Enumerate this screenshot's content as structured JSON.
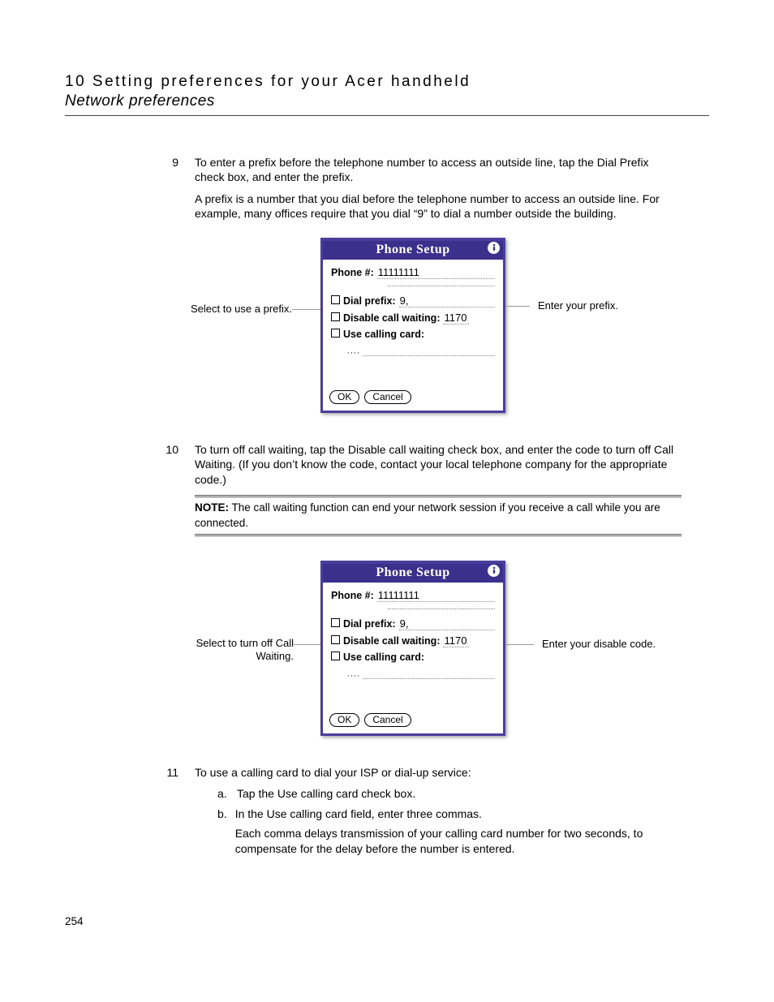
{
  "header": {
    "chapter": "10 Setting preferences for your Acer handheld",
    "section": "Network preferences"
  },
  "steps": {
    "s9": {
      "num": "9",
      "p1": "To enter a prefix before the telephone number to access an outside line, tap the Dial Prefix check box, and enter the prefix.",
      "p2": "A prefix is a number that you dial before the telephone number to access an outside line. For example, many offices require that you dial “9” to dial a number outside the building."
    },
    "s10": {
      "num": "10",
      "p1": "To turn off call waiting, tap the Disable call waiting check box, and enter the code to turn off Call Waiting. (If you don’t know the code, contact your local telephone company for the appropriate code.)"
    },
    "s11": {
      "num": "11",
      "p1": "To use a calling card to dial your ISP or dial-up service:",
      "a": "Tap the Use calling card check box.",
      "b": "In the Use calling card field, enter three commas.",
      "b2": "Each comma delays transmission of your calling card number for two seconds, to compensate for the delay before the number is entered."
    }
  },
  "note": {
    "label": "NOTE:",
    "text": "The call waiting function can end your network session if you receive a call while you are connected."
  },
  "callouts": {
    "fig1_left": "Select to use a prefix.",
    "fig1_right": "Enter your prefix.",
    "fig2_left": "Select to turn off Call Waiting.",
    "fig2_right": "Enter your disable code."
  },
  "dialog": {
    "title": "Phone Setup",
    "phone_label": "Phone #:",
    "phone_value": "11111111",
    "dial_prefix_label": "Dial prefix:",
    "dial_prefix_value": "9,",
    "disable_cw_label": "Disable call waiting:",
    "disable_cw_value": "1170,",
    "use_card_label": "Use calling card:",
    "card_value": ",,,,",
    "ok": "OK",
    "cancel": "Cancel"
  },
  "page_number": "254"
}
